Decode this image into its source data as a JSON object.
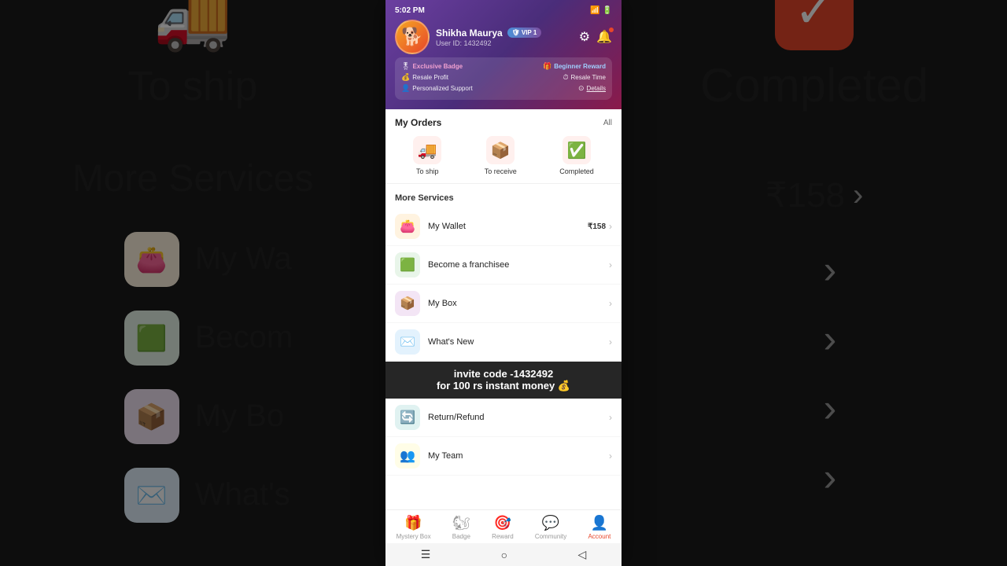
{
  "status_bar": {
    "time": "5:02 PM",
    "wifi_icon": "📶",
    "battery_icon": "🔋"
  },
  "profile": {
    "name": "Shikha Maurya",
    "user_id_label": "User ID: 1432492",
    "vip_label": "VIP 1",
    "avatar_emoji": "🐕"
  },
  "header_icons": {
    "settings": "⚙",
    "notifications": "🔔"
  },
  "benefits": {
    "exclusive_badge_label": "Exclusive Badge",
    "beginner_reward_label": "Beginner Reward",
    "resale_profit_label": "Resale Profit",
    "resale_time_label": "Resale Time",
    "personalized_support_label": "Personalized Support",
    "details_label": "Details"
  },
  "orders": {
    "section_title": "My Orders",
    "all_label": "All",
    "tabs": [
      {
        "icon": "🚚",
        "label": "To ship"
      },
      {
        "icon": "📦",
        "label": "To receive"
      },
      {
        "icon": "✅",
        "label": "Completed"
      }
    ]
  },
  "more_services": {
    "title": "More Services",
    "items": [
      {
        "icon": "👛",
        "icon_class": "icon-orange",
        "label": "My Wallet",
        "value": "₹158",
        "has_chevron": true
      },
      {
        "icon": "🟩",
        "icon_class": "icon-green",
        "label": "Become a franchisee",
        "value": "",
        "has_chevron": true
      },
      {
        "icon": "📦",
        "icon_class": "icon-purple",
        "label": "My Box",
        "value": "",
        "has_chevron": true
      },
      {
        "icon": "✉️",
        "icon_class": "icon-blue",
        "label": "What's New",
        "value": "",
        "has_chevron": true
      },
      {
        "icon": "🔄",
        "icon_class": "icon-teal",
        "label": "Return/Refund",
        "value": "",
        "has_chevron": true
      },
      {
        "icon": "👥",
        "icon_class": "icon-yellow",
        "label": "My Team",
        "value": "",
        "has_chevron": true
      }
    ]
  },
  "invite_banner": {
    "line1": "invite code -1432492",
    "line2": "for 100 rs instant money 💰"
  },
  "bottom_nav": {
    "items": [
      {
        "icon": "🎁",
        "label": "Mystery Box",
        "active": false
      },
      {
        "icon": "🐿",
        "label": "Badge",
        "active": false
      },
      {
        "icon": "🎯",
        "label": "Reward",
        "active": false
      },
      {
        "icon": "💬",
        "label": "Community",
        "active": false
      },
      {
        "icon": "👤",
        "label": "Account",
        "active": true
      }
    ]
  },
  "android_nav": {
    "menu_icon": "☰",
    "home_icon": "○",
    "back_icon": "◁"
  },
  "bg_left": {
    "ship_label": "To ship",
    "more_services_label": "More Services",
    "wallet_label": "My Wa",
    "franchise_label": "Becom",
    "box_label": "My Bo",
    "whats_label": "What's"
  },
  "bg_right": {
    "completed_label": "Completed",
    "wallet_amount": "₹158",
    "chevron": "›"
  }
}
